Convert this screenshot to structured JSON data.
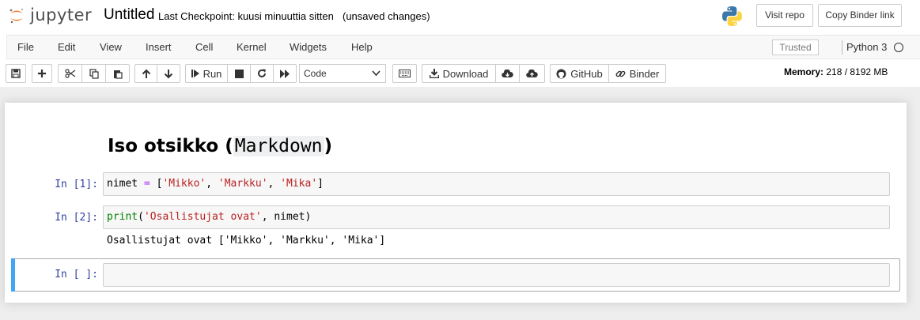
{
  "header": {
    "logo_text": "jupyter",
    "notebook_title": "Untitled",
    "checkpoint": "Last Checkpoint: kuusi minuuttia sitten",
    "unsaved": "(unsaved changes)",
    "visit_repo": "Visit repo",
    "copy_binder_link": "Copy Binder link"
  },
  "menubar": {
    "items": [
      "File",
      "Edit",
      "View",
      "Insert",
      "Cell",
      "Kernel",
      "Widgets",
      "Help"
    ],
    "trusted": "Trusted",
    "kernel": "Python 3"
  },
  "toolbar": {
    "run": "Run",
    "cell_type": "Code",
    "download": "Download",
    "github": "GitHub",
    "binder": "Binder",
    "memory_label": "Memory:",
    "memory_value": "218 / 8192 MB"
  },
  "notebook": {
    "markdown_heading": "Iso otsikko (",
    "markdown_code": "Markdown",
    "markdown_close": ")",
    "cells": [
      {
        "prompt": "In [1]:",
        "code": {
          "v": "nimet",
          "eq": " = ",
          "open": "[",
          "s1": "'Mikko'",
          "c1": ", ",
          "s2": "'Markku'",
          "c2": ", ",
          "s3": "'Mika'",
          "close": "]"
        }
      },
      {
        "prompt": "In [2]:",
        "code": {
          "fn": "print",
          "open": "(",
          "s": "'Osallistujat ovat'",
          "rest": ", nimet",
          "close": ")"
        },
        "output": "Osallistujat ovat ['Mikko', 'Markku', 'Mika']"
      },
      {
        "prompt": "In [ ]:",
        "code": ""
      }
    ]
  },
  "colors": {
    "prompt_blue": "#303f9f",
    "string_red": "#ba2121",
    "builtin_green": "#008000",
    "operator_purple": "#aa22ff",
    "selected_cell_bar": "#42a5f5"
  }
}
